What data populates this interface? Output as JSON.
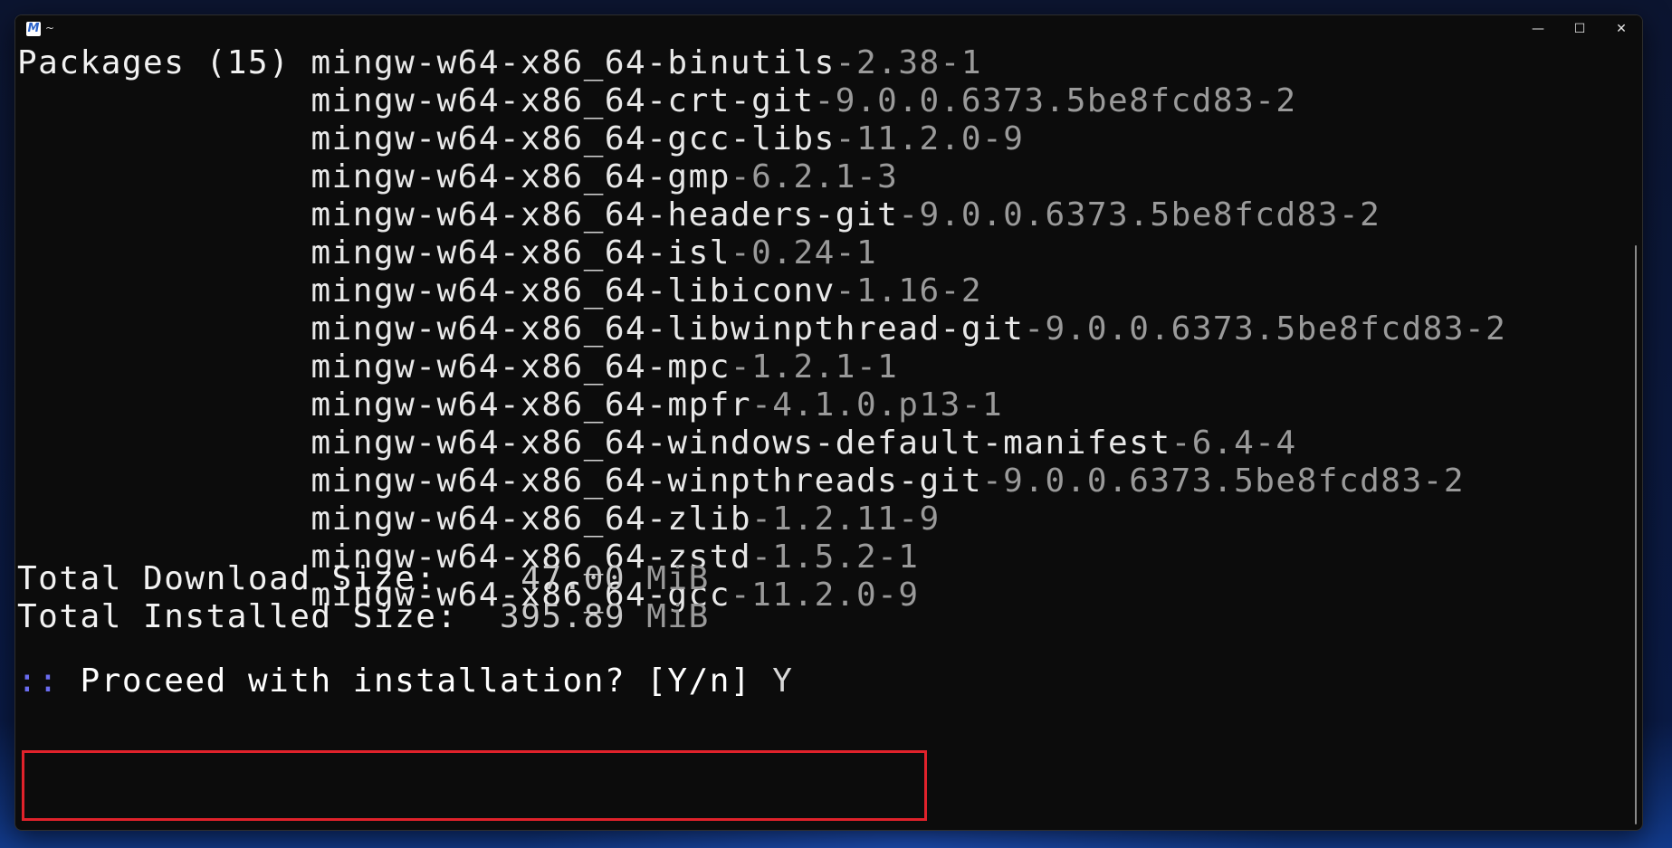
{
  "window": {
    "title": "~",
    "icon_name": "msys2-icon",
    "controls": {
      "minimize": "—",
      "maximize": "☐",
      "close": "✕"
    }
  },
  "terminal": {
    "packages_label": "Packages (15)",
    "packages": [
      {
        "name": "mingw-w64-x86_64-binutils",
        "version": "-2.38-1"
      },
      {
        "name": "mingw-w64-x86_64-crt-git",
        "version": "-9.0.0.6373.5be8fcd83-2"
      },
      {
        "name": "mingw-w64-x86_64-gcc-libs",
        "version": "-11.2.0-9"
      },
      {
        "name": "mingw-w64-x86_64-gmp",
        "version": "-6.2.1-3"
      },
      {
        "name": "mingw-w64-x86_64-headers-git",
        "version": "-9.0.0.6373.5be8fcd83-2"
      },
      {
        "name": "mingw-w64-x86_64-isl",
        "version": "-0.24-1"
      },
      {
        "name": "mingw-w64-x86_64-libiconv",
        "version": "-1.16-2"
      },
      {
        "name": "mingw-w64-x86_64-libwinpthread-git",
        "version": "-9.0.0.6373.5be8fcd83-2"
      },
      {
        "name": "mingw-w64-x86_64-mpc",
        "version": "-1.2.1-1"
      },
      {
        "name": "mingw-w64-x86_64-mpfr",
        "version": "-4.1.0.p13-1"
      },
      {
        "name": "mingw-w64-x86_64-windows-default-manifest",
        "version": "-6.4-4"
      },
      {
        "name": "mingw-w64-x86_64-winpthreads-git",
        "version": "-9.0.0.6373.5be8fcd83-2"
      },
      {
        "name": "mingw-w64-x86_64-zlib",
        "version": "-1.2.11-9"
      },
      {
        "name": "mingw-w64-x86_64-zstd",
        "version": "-1.5.2-1"
      },
      {
        "name": "mingw-w64-x86_64-gcc",
        "version": "-11.2.0-9"
      }
    ],
    "download_size": {
      "label": "Total Download Size:",
      "value": "47.00",
      "unit": "MiB"
    },
    "installed_size": {
      "label": "Total Installed Size:",
      "value": "395.89",
      "unit": "MiB"
    },
    "prompt": {
      "marker": "::",
      "question": "Proceed with installation? [Y/n]",
      "answer": "Y"
    }
  },
  "colors": {
    "terminal_bg": "#0c0c0c",
    "version_text": "#9a9a9a",
    "prompt_marker": "#6a6cf0",
    "highlight_border": "#e0222b"
  }
}
